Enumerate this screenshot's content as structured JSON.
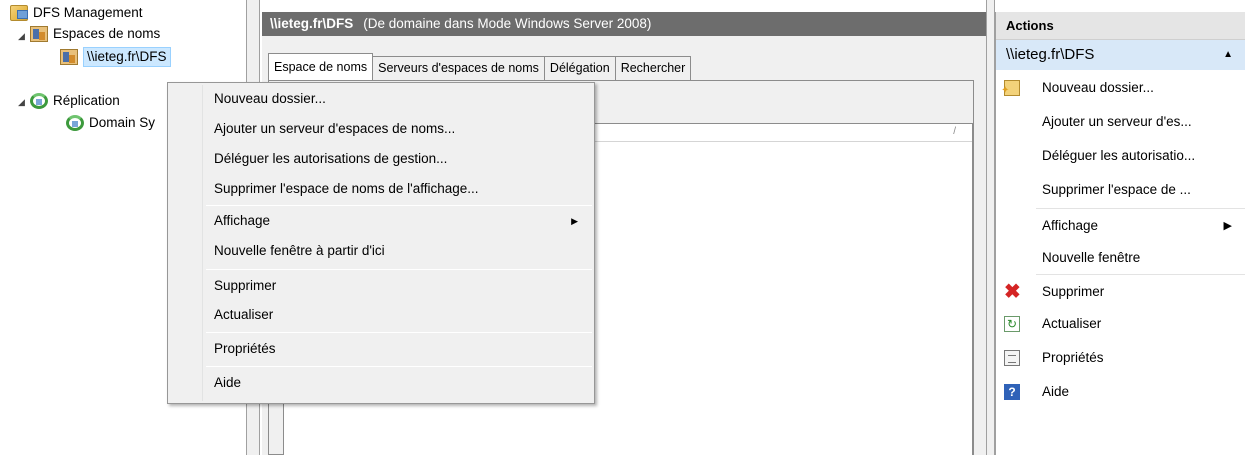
{
  "tree": {
    "root_label": "DFS Management",
    "namespaces_label": "Espaces de noms",
    "namespace_item_label": "\\\\ieteg.fr\\DFS",
    "replication_label": "Réplication",
    "domain_item_label": "Domain Sy"
  },
  "center": {
    "header_path": "\\\\ieteg.fr\\DFS",
    "header_desc": "(De domaine dans Mode Windows Server 2008)",
    "tabs": [
      {
        "label": "Espace de noms",
        "active": true
      },
      {
        "label": "Serveurs d'espaces de noms",
        "active": false
      },
      {
        "label": "Délégation",
        "active": false
      },
      {
        "label": "Rechercher",
        "active": false
      }
    ]
  },
  "context_menu": {
    "items": [
      {
        "label": "Nouveau dossier..."
      },
      {
        "label": "Ajouter un serveur d'espaces de noms..."
      },
      {
        "label": "Déléguer les autorisations de gestion..."
      },
      {
        "label": "Supprimer l'espace de noms de l'affichage..."
      },
      {
        "label": "Affichage",
        "submenu": true
      },
      {
        "label": "Nouvelle fenêtre à partir d'ici"
      },
      {
        "label": "Supprimer"
      },
      {
        "label": "Actualiser"
      },
      {
        "label": "Propriétés"
      },
      {
        "label": "Aide"
      }
    ]
  },
  "actions": {
    "title": "Actions",
    "section_title": "\\\\ieteg.fr\\DFS",
    "items": [
      {
        "label": "Nouveau dossier...",
        "icon": "new-folder-icon"
      },
      {
        "label": "Ajouter un serveur d'es...",
        "icon": ""
      },
      {
        "label": "Déléguer les autorisatio...",
        "icon": ""
      },
      {
        "label": "Supprimer l'espace de ...",
        "icon": ""
      },
      {
        "label": "Affichage",
        "icon": "",
        "submenu": true
      },
      {
        "label": "Nouvelle fenêtre",
        "icon": ""
      },
      {
        "label": "Supprimer",
        "icon": "delete-icon"
      },
      {
        "label": "Actualiser",
        "icon": "refresh-icon"
      },
      {
        "label": "Propriétés",
        "icon": "properties-icon"
      },
      {
        "label": "Aide",
        "icon": "help-icon"
      }
    ]
  },
  "colors": {
    "header_bg": "#6d6d6d",
    "selection_bg": "#cce8ff",
    "actions_section_bg": "#d8e8f8",
    "delete_red": "#d42424"
  }
}
